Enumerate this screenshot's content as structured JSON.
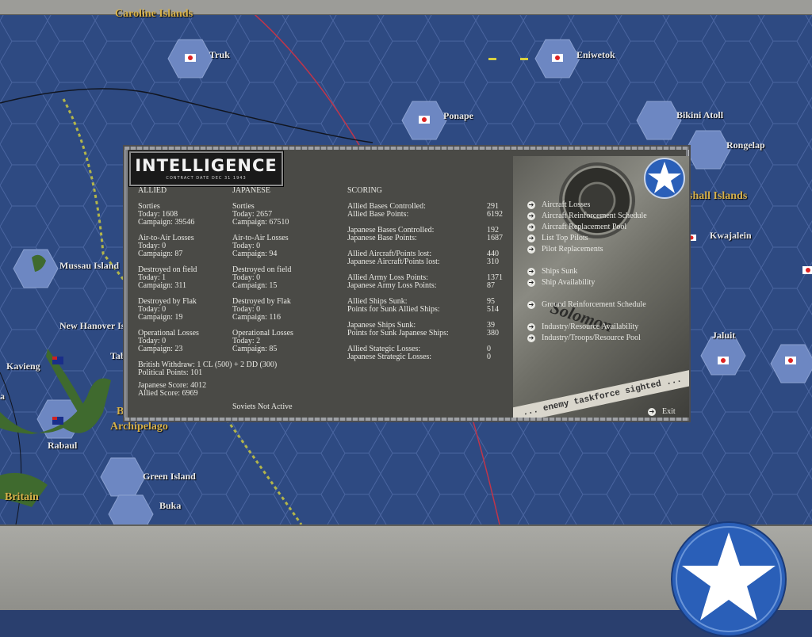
{
  "map": {
    "labels": {
      "caroline_islands": "Caroline Islands",
      "truk": "Truk",
      "eniwetok": "Eniwetok",
      "ponape": "Ponape",
      "bikini_atoll": "Bikini Atoll",
      "rongelap": "Rongelap",
      "marshall_islands": "shall Islands",
      "kwajalein": "Kwajalein",
      "mussau_island": "Mussau Island",
      "new_hanover": "New Hanover Is",
      "tab": "Tab",
      "kavieng": "Kavieng",
      "rabaul": "Rabaul",
      "bismarck": "B",
      "archipelago": "Archipelago",
      "green_island": "Green Island",
      "buka": "Buka",
      "new_britain": "Britain",
      "jaluit": "Jaluit",
      "edge_a": "a"
    }
  },
  "dialog": {
    "title": "INTELLIGENCE",
    "subtitle": "CONTRACT DATE DEC 31 1943",
    "photo_text_1": "Solomon",
    "photo_text_2": "... enemy taskforce sighted ...",
    "allied": {
      "header": "ALLIED",
      "sorties": {
        "label": "Sorties",
        "today": "Today:      1608",
        "campaign": "Campaign: 39546"
      },
      "air_to_air": {
        "label": "Air-to-Air Losses",
        "today": "Today:      0",
        "campaign": "Campaign: 87"
      },
      "destroyed_field": {
        "label": "Destroyed on field",
        "today": "Today:      1",
        "campaign": "Campaign: 311"
      },
      "destroyed_flak": {
        "label": "Destroyed by Flak",
        "today": "Today:      0",
        "campaign": "Campaign: 19"
      },
      "operational": {
        "label": "Operational Losses",
        "today": "Today:      0",
        "campaign": "Campaign: 23"
      }
    },
    "japanese": {
      "header": "JAPANESE",
      "sorties": {
        "label": "Sorties",
        "today": "Today:      2657",
        "campaign": "Campaign: 67510"
      },
      "air_to_air": {
        "label": "Air-to-Air Losses",
        "today": "Today:      0",
        "campaign": "Campaign: 94"
      },
      "destroyed_field": {
        "label": "Destroyed on field",
        "today": "Today:      0",
        "campaign": "Campaign: 15"
      },
      "destroyed_flak": {
        "label": "Destroyed by Flak",
        "today": "Today:      0",
        "campaign": "Campaign: 116"
      },
      "operational": {
        "label": "Operational Losses",
        "today": "Today:      2",
        "campaign": "Campaign: 85"
      }
    },
    "footer": {
      "british_withdraw": "British Withdraw: 1 CL (500) + 2 DD (300)",
      "political_points": "Political Points: 101",
      "japanese_score": "Japanese Score: 4012",
      "allied_score": "Allied Score: 6969",
      "soviets": "Soviets Not Active"
    },
    "scoring": {
      "header": "SCORING",
      "rows": [
        {
          "label": "Allied Bases Controlled:",
          "value": "291"
        },
        {
          "label": "Allied Base Points:",
          "value": "6192"
        },
        {
          "label": "Japanese Bases Controlled:",
          "value": "192"
        },
        {
          "label": "Japanese Base Points:",
          "value": "1687"
        },
        {
          "label": "Allied Aircraft/Points lost:",
          "value": "440"
        },
        {
          "label": "Japanese Aircraft/Points lost:",
          "value": "310"
        },
        {
          "label": "Allied Army Loss Points:",
          "value": "1371"
        },
        {
          "label": "Japanese Army Loss Points:",
          "value": "87"
        },
        {
          "label": "Allied Ships Sunk:",
          "value": "95"
        },
        {
          "label": "Points for Sunk Allied Ships:",
          "value": "514"
        },
        {
          "label": "Japanese Ships Sunk:",
          "value": "39"
        },
        {
          "label": "Points for Sunk Japanese Ships:",
          "value": "380"
        },
        {
          "label": "Allied Stategic Losses:",
          "value": "0"
        },
        {
          "label": "Japanese Strategic Losses:",
          "value": "0"
        }
      ]
    },
    "links": [
      "Aircraft Losses",
      "Aircraft Reinforcement Schedule",
      "Aircraft Replacement Pool",
      "List Top Pilots",
      "Pilot Replacements",
      "Ships Sunk",
      "Ship Availability",
      "Ground Reinforcement Schedule",
      "Industry/Resource Availability",
      "Industry/Troops/Resource Pool"
    ],
    "exit_label": "Exit"
  },
  "colors": {
    "ocean": "#2e4a82",
    "hex_line": "#4a65a0",
    "dialog_bg": "#4a4a46",
    "text": "#e9e9e4",
    "gold_label": "#d7b14a"
  }
}
